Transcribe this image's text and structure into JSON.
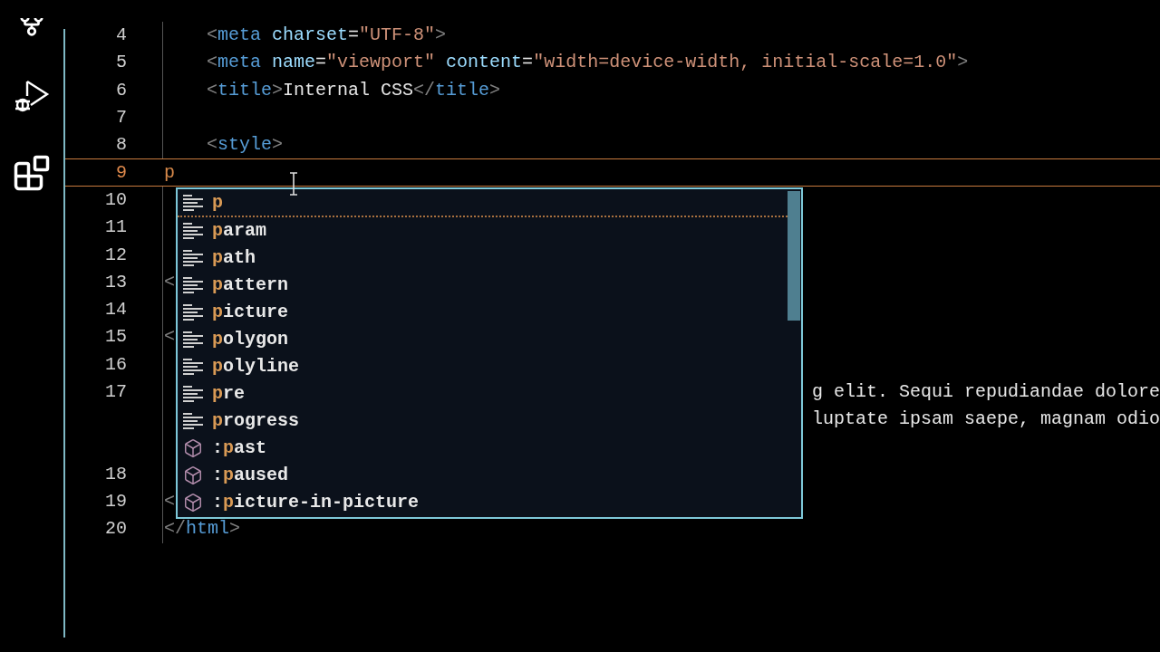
{
  "activity_bar": {
    "items": [
      {
        "kind": "source"
      },
      {
        "kind": "debug"
      },
      {
        "kind": "extensions"
      }
    ]
  },
  "editor": {
    "lines": [
      {
        "number": "4",
        "indented": true,
        "current": false,
        "tokens": [
          {
            "kind": "bracket",
            "text": "<"
          },
          {
            "kind": "tag",
            "text": "meta"
          },
          {
            "kind": "attr",
            "text": " charset"
          },
          {
            "kind": "plain",
            "text": "="
          },
          {
            "kind": "string",
            "text": "\"UTF-8\""
          },
          {
            "kind": "bracket",
            "text": ">"
          }
        ]
      },
      {
        "number": "5",
        "indented": true,
        "current": false,
        "tokens": [
          {
            "kind": "bracket",
            "text": "<"
          },
          {
            "kind": "tag",
            "text": "meta"
          },
          {
            "kind": "attr",
            "text": " name"
          },
          {
            "kind": "plain",
            "text": "="
          },
          {
            "kind": "string",
            "text": "\"viewport\""
          },
          {
            "kind": "attr",
            "text": " content"
          },
          {
            "kind": "plain",
            "text": "="
          },
          {
            "kind": "string",
            "text": "\"width=device-width, initial-scale=1.0\""
          },
          {
            "kind": "bracket",
            "text": ">"
          }
        ]
      },
      {
        "number": "6",
        "indented": true,
        "current": false,
        "tokens": [
          {
            "kind": "bracket",
            "text": "<"
          },
          {
            "kind": "tag",
            "text": "title"
          },
          {
            "kind": "bracket",
            "text": ">"
          },
          {
            "kind": "plain",
            "text": "Internal CSS"
          },
          {
            "kind": "bracket",
            "text": "</"
          },
          {
            "kind": "tag",
            "text": "title"
          },
          {
            "kind": "bracket",
            "text": ">"
          }
        ]
      },
      {
        "number": "7",
        "current": false
      },
      {
        "number": "8",
        "indented": true,
        "current": false,
        "tokens": [
          {
            "kind": "bracket",
            "text": "<"
          },
          {
            "kind": "tag",
            "text": "style"
          },
          {
            "kind": "bracket",
            "text": ">"
          }
        ]
      },
      {
        "number": "9",
        "indented": false,
        "current": true,
        "tokens": [
          {
            "kind": "typed",
            "text": "p"
          }
        ]
      },
      {
        "number": "10",
        "current": false
      },
      {
        "number": "11",
        "current": false
      },
      {
        "number": "12",
        "current": false
      },
      {
        "number": "13",
        "indented": false,
        "current": false,
        "tokens": [
          {
            "kind": "bracket",
            "text": "<"
          }
        ]
      },
      {
        "number": "14",
        "current": false
      },
      {
        "number": "15",
        "indented": false,
        "current": false,
        "tokens": [
          {
            "kind": "bracket",
            "text": "<"
          }
        ]
      },
      {
        "number": "16",
        "current": false
      },
      {
        "number": "17",
        "current": false,
        "beside_popup": "g elit. Sequi repudiandae dolore"
      },
      {
        "current": false,
        "beside_popup": "luptate ipsam saepe, magnam odio"
      },
      {
        "current": false
      },
      {
        "number": "18",
        "current": false
      },
      {
        "number": "19",
        "indented": false,
        "current": false,
        "tokens": [
          {
            "kind": "bracket",
            "text": "<"
          }
        ]
      },
      {
        "number": "20",
        "indented": false,
        "current": false,
        "tokens": [
          {
            "kind": "bracket",
            "text": "</"
          },
          {
            "kind": "tag",
            "text": "html"
          },
          {
            "kind": "bracket",
            "text": ">"
          }
        ]
      }
    ]
  },
  "suggestions": {
    "items": [
      {
        "kind": "element",
        "match": "p",
        "selected": true
      },
      {
        "kind": "element",
        "match": "p",
        "after": "aram",
        "selected": false
      },
      {
        "kind": "element",
        "match": "p",
        "after": "ath",
        "selected": false
      },
      {
        "kind": "element",
        "match": "p",
        "after": "attern",
        "selected": false
      },
      {
        "kind": "element",
        "match": "p",
        "after": "icture",
        "selected": false
      },
      {
        "kind": "element",
        "match": "p",
        "after": "olygon",
        "selected": false
      },
      {
        "kind": "element",
        "match": "p",
        "after": "olyline",
        "selected": false
      },
      {
        "kind": "element",
        "match": "p",
        "after": "re",
        "selected": false
      },
      {
        "kind": "element",
        "match": "p",
        "after": "rogress",
        "selected": false
      },
      {
        "kind": "pseudo",
        "before": ":",
        "match": "p",
        "after": "ast",
        "selected": false
      },
      {
        "kind": "pseudo",
        "before": ":",
        "match": "p",
        "after": "aused",
        "selected": false
      },
      {
        "kind": "pseudo",
        "before": ":",
        "match": "p",
        "after": "icture-in-picture",
        "selected": false
      }
    ]
  }
}
